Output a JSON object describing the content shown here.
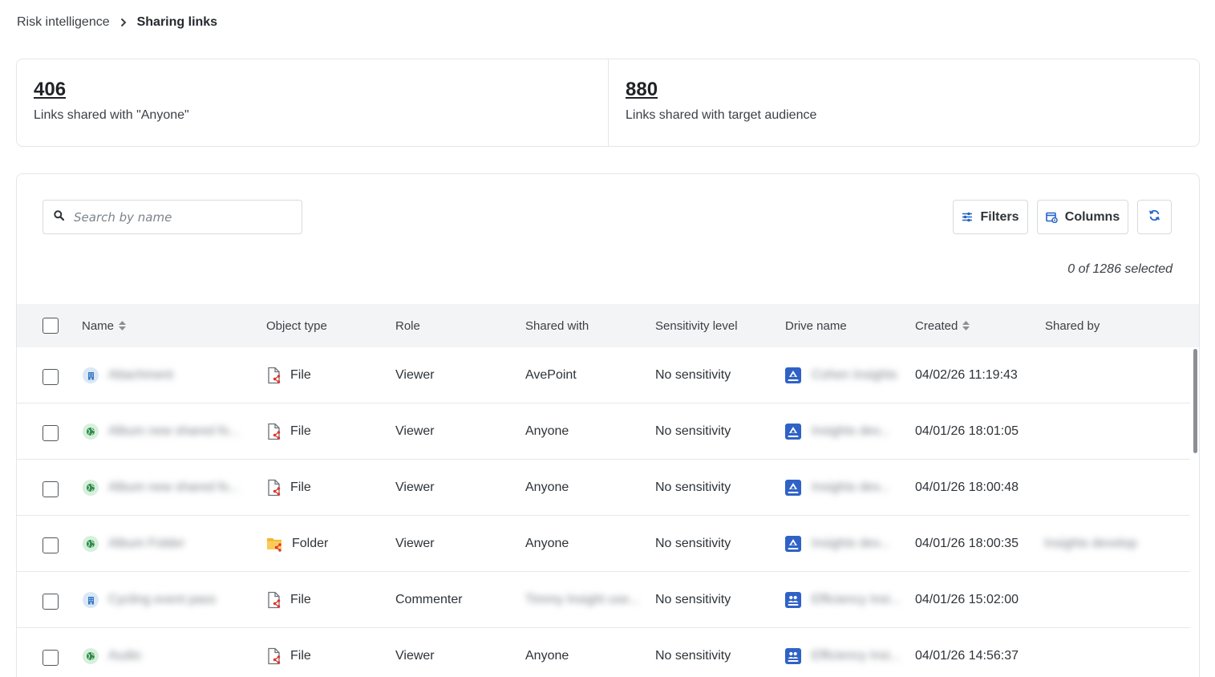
{
  "breadcrumb": {
    "parent": "Risk intelligence",
    "current": "Sharing links"
  },
  "stats": [
    {
      "value": "406",
      "label": "Links shared with \"Anyone\""
    },
    {
      "value": "880",
      "label": "Links shared with target audience"
    }
  ],
  "toolbar": {
    "search_placeholder": "Search by name",
    "filters_label": "Filters",
    "columns_label": "Columns",
    "selected_text": "0 of 1286 selected"
  },
  "table": {
    "columns": [
      "Name",
      "Object type",
      "Role",
      "Shared with",
      "Sensitivity level",
      "Drive name",
      "Created",
      "Shared by"
    ],
    "rows": [
      {
        "name_icon": "building-icon",
        "name": "Attachment",
        "object_type": "File",
        "type_icon": "file-share-icon",
        "role": "Viewer",
        "shared_with": "AvePoint",
        "sensitivity": "No sensitivity",
        "drive_icon": "drive-icon",
        "drive_name": "Cohen Insights",
        "created": "04/02/26 11:19:43",
        "shared_by": ""
      },
      {
        "name_icon": "globe-icon",
        "name": "Album new shared fo...",
        "object_type": "File",
        "type_icon": "file-share-icon",
        "role": "Viewer",
        "shared_with": "Anyone",
        "sensitivity": "No sensitivity",
        "drive_icon": "drive-icon",
        "drive_name": "Insights dev...",
        "created": "04/01/26 18:01:05",
        "shared_by": ""
      },
      {
        "name_icon": "globe-icon",
        "name": "Album new shared fo...",
        "object_type": "File",
        "type_icon": "file-share-icon",
        "role": "Viewer",
        "shared_with": "Anyone",
        "sensitivity": "No sensitivity",
        "drive_icon": "drive-icon",
        "drive_name": "Insights dev...",
        "created": "04/01/26 18:00:48",
        "shared_by": ""
      },
      {
        "name_icon": "globe-icon",
        "name": "Album Folder",
        "object_type": "Folder",
        "type_icon": "folder-share-icon",
        "role": "Viewer",
        "shared_with": "Anyone",
        "sensitivity": "No sensitivity",
        "drive_icon": "drive-icon",
        "drive_name": "Insights dev...",
        "created": "04/01/26 18:00:35",
        "shared_by": "Insights develop"
      },
      {
        "name_icon": "building-icon",
        "name": "Cycling event pass",
        "object_type": "File",
        "type_icon": "file-share-icon",
        "role": "Commenter",
        "shared_with": "Timmy Insight use...",
        "sensitivity": "No sensitivity",
        "drive_icon": "shared-drive-icon",
        "drive_name": "Efficiency Insi...",
        "created": "04/01/26 15:02:00",
        "shared_by": ""
      },
      {
        "name_icon": "globe-icon",
        "name": "Audio",
        "object_type": "File",
        "type_icon": "file-share-icon",
        "role": "Viewer",
        "shared_with": "Anyone",
        "sensitivity": "No sensitivity",
        "drive_icon": "shared-drive-icon",
        "drive_name": "Efficiency Insi...",
        "created": "04/01/26 14:56:37",
        "shared_by": ""
      }
    ]
  },
  "colors": {
    "accent_blue": "#2563c9",
    "drive_icon_blue": "#2f62c6",
    "file_icon_red": "#e0342f",
    "folder_yellow": "#f5b431",
    "globe_green": "#2e8c48",
    "building_blue": "#3b78c2",
    "header_bg": "#f3f4f6"
  },
  "blurred_values_note": "Name, Drive name, some Shared with/by values are blurred in the original"
}
